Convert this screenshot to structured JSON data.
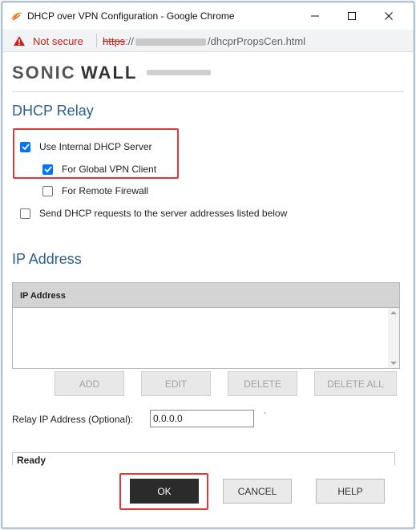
{
  "window": {
    "title": "DHCP over VPN Configuration - Google Chrome",
    "min_symbol": "—",
    "max_symbol": "☐",
    "close_symbol": "✕"
  },
  "address_bar": {
    "security_label": "Not secure",
    "url_scheme": "https",
    "url_prefix": "://",
    "url_path": "/dhcprPropsCen.html"
  },
  "brand": {
    "logo_text": "SONICWALL"
  },
  "dhcp_relay": {
    "title": "DHCP Relay",
    "options": [
      {
        "label": "Use Internal DHCP Server",
        "checked": true
      },
      {
        "label": "For Global VPN Client",
        "checked": true
      },
      {
        "label": "For Remote Firewall",
        "checked": false
      },
      {
        "label": "Send DHCP requests to the server addresses listed below",
        "checked": false
      }
    ]
  },
  "ip_address": {
    "title": "IP Address",
    "table_header": "IP Address",
    "rows": [],
    "buttons": {
      "add": "ADD",
      "edit": "EDIT",
      "delete": "DELETE",
      "delete_all": "DELETE ALL"
    }
  },
  "relay": {
    "label": "Relay IP Address (Optional):",
    "value": "0.0.0.0"
  },
  "status": "Ready",
  "dialog_buttons": {
    "ok": "OK",
    "cancel": "CANCEL",
    "help": "HELP"
  },
  "colors": {
    "accent": "#0075ff",
    "section_title": "#2d5f8a",
    "highlight_box": "#e8323c",
    "not_secure": "#c5221f"
  },
  "icons": {
    "browser": "chrome-icon",
    "security": "warning-icon",
    "checkbox": "checkmark-icon"
  }
}
